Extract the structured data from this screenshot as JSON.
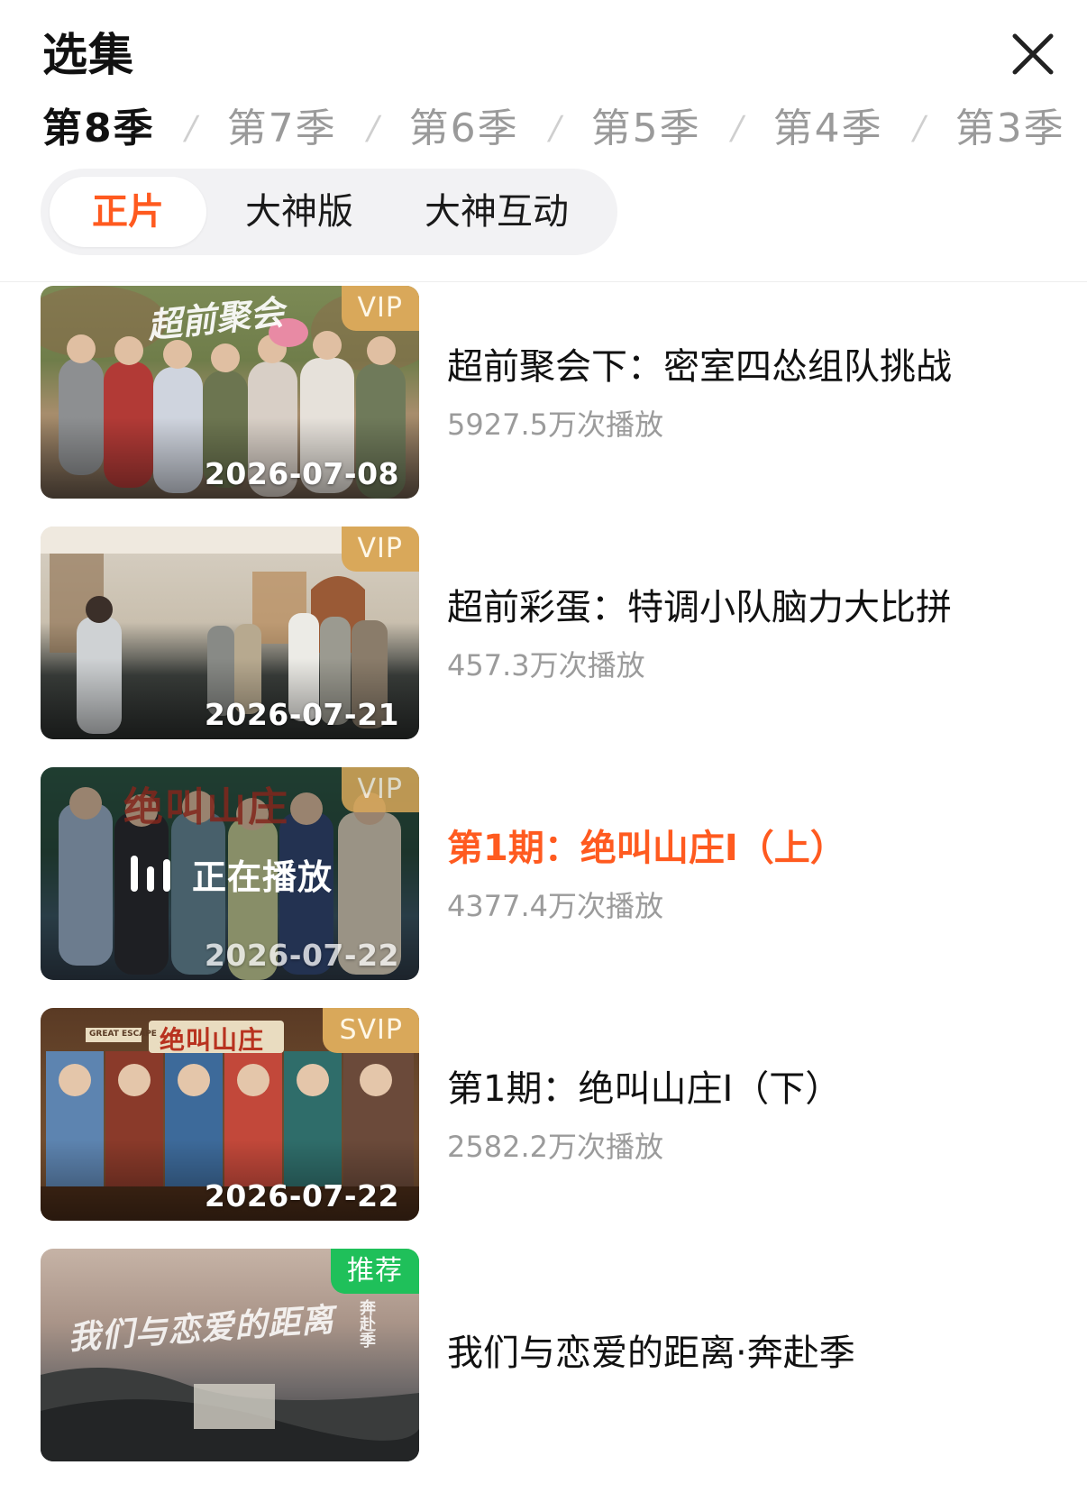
{
  "header": {
    "title": "选集",
    "close_icon": "close-icon"
  },
  "seasons": {
    "active": "第8季",
    "items": [
      {
        "label": "第8季"
      },
      {
        "label": "第7季"
      },
      {
        "label": "第6季"
      },
      {
        "label": "第5季"
      },
      {
        "label": "第4季"
      },
      {
        "label": "第3季"
      }
    ],
    "separator": "/"
  },
  "versions": {
    "active": "正片",
    "items": [
      {
        "label": "正片"
      },
      {
        "label": "大神版"
      },
      {
        "label": "大神互动"
      }
    ]
  },
  "episodes": [
    {
      "title": "超前聚会下：密室四怂组队挑战",
      "views": "5927.5万次播放",
      "date": "2026-07-08",
      "badge": "VIP",
      "thumb_text": "超前聚会"
    },
    {
      "title": "超前彩蛋：特调小队脑力大比拼",
      "views": "457.3万次播放",
      "date": "2026-07-21",
      "badge": "VIP"
    },
    {
      "title": "第1期：绝叫山庄I（上）",
      "views": "4377.4万次播放",
      "date": "2026-07-22",
      "badge": "VIP",
      "playing_label": "正在播放",
      "thumb_text": "绝叫山庄",
      "is_current": true
    },
    {
      "title": "第1期：绝叫山庄I（下）",
      "views": "2582.2万次播放",
      "date": "2026-07-22",
      "badge": "SVIP",
      "thumb_text": "绝叫山庄",
      "thumb_small_text": "GREAT ESCAPE"
    },
    {
      "title": "我们与恋爱的距离·奔赴季",
      "badge": "推荐",
      "thumb_text": "我们与恋爱的距离",
      "thumb_side_text": "奔赴季"
    }
  ],
  "colors": {
    "accent": "#ff5a1f",
    "vip_badge": "#d9a85a",
    "recommend_badge": "#1fc05a",
    "muted_text": "#9b9b9b",
    "segment_bg": "#f2f2f4"
  }
}
